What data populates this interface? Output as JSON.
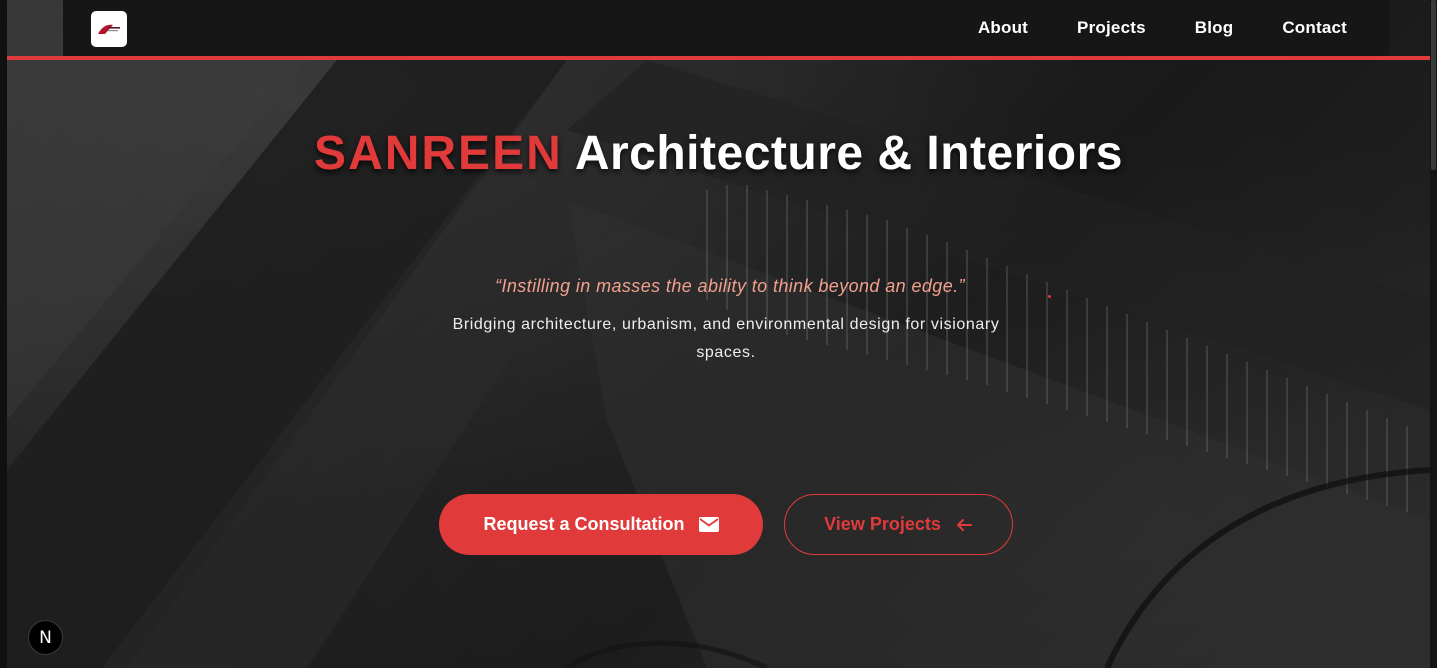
{
  "header": {
    "logo_icon": "sanreen-logo-icon",
    "nav": [
      {
        "label": "About"
      },
      {
        "label": "Projects"
      },
      {
        "label": "Blog"
      },
      {
        "label": "Contact"
      }
    ]
  },
  "hero": {
    "brand": "SANREEN",
    "title_rest": "Architecture & Interiors",
    "quote": "“Instilling in masses the ability to think beyond an edge.”",
    "description": "Bridging architecture, urbanism, and environmental design for visionary spaces.",
    "primary_button": {
      "label": "Request a Consultation",
      "icon": "mail-icon"
    },
    "secondary_button": {
      "label": "View Projects",
      "icon": "arrow-left-icon"
    }
  },
  "next_badge": {
    "label": "N",
    "icon": "nextjs-icon"
  },
  "colors": {
    "accent": "#e03a3a",
    "header_bg": "#161616",
    "quote": "#f1a08e"
  }
}
